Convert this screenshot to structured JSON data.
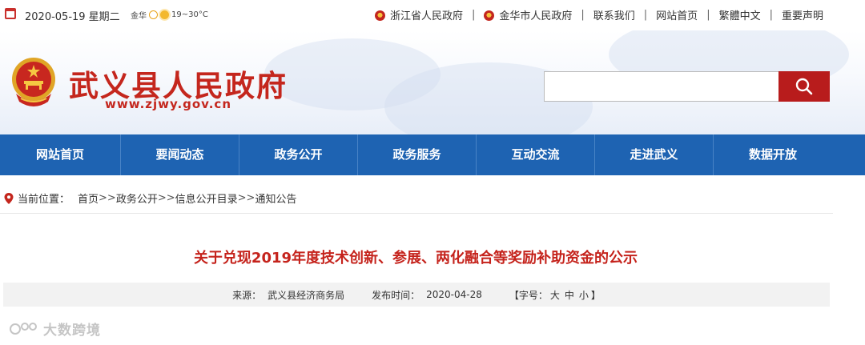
{
  "topbar": {
    "date": "2020-05-19 星期二",
    "weather_city": "金华",
    "weather_temp": "19~30°C",
    "links": [
      {
        "label": "浙江省人民政府",
        "emblem": true
      },
      {
        "label": "金华市人民政府",
        "emblem": true
      },
      {
        "label": "联系我们",
        "emblem": false
      },
      {
        "label": "网站首页",
        "emblem": false
      },
      {
        "label": "繁體中文",
        "emblem": false
      },
      {
        "label": "重要声明",
        "emblem": false
      }
    ],
    "separator": "|"
  },
  "header": {
    "site_title": "武义县人民政府",
    "site_url": "www.zjwy.gov.cn",
    "search_placeholder": "",
    "search_icon": "search-icon"
  },
  "nav": {
    "items": [
      "网站首页",
      "要闻动态",
      "政务公开",
      "政务服务",
      "互动交流",
      "走进武义",
      "数据开放"
    ]
  },
  "breadcrumb": {
    "prefix": "当前位置：",
    "items": [
      "首页",
      "政务公开",
      "信息公开目录",
      "通知公告"
    ],
    "separator": ">>"
  },
  "article": {
    "title": "关于兑现2019年度技术创新、参展、两化融合等奖励补助资金的公示",
    "source_label": "来源：",
    "source": "武义县经济商务局",
    "date_label": "发布时间：",
    "date": "2020-04-28",
    "font_size_label": "【字号：",
    "font_sizes": [
      "大",
      "中",
      "小"
    ],
    "font_size_close": "】"
  },
  "watermark": "大数跨境",
  "colors": {
    "brand_red": "#c4261d",
    "nav_blue": "#1e63b2",
    "search_red": "#b81c1c"
  }
}
